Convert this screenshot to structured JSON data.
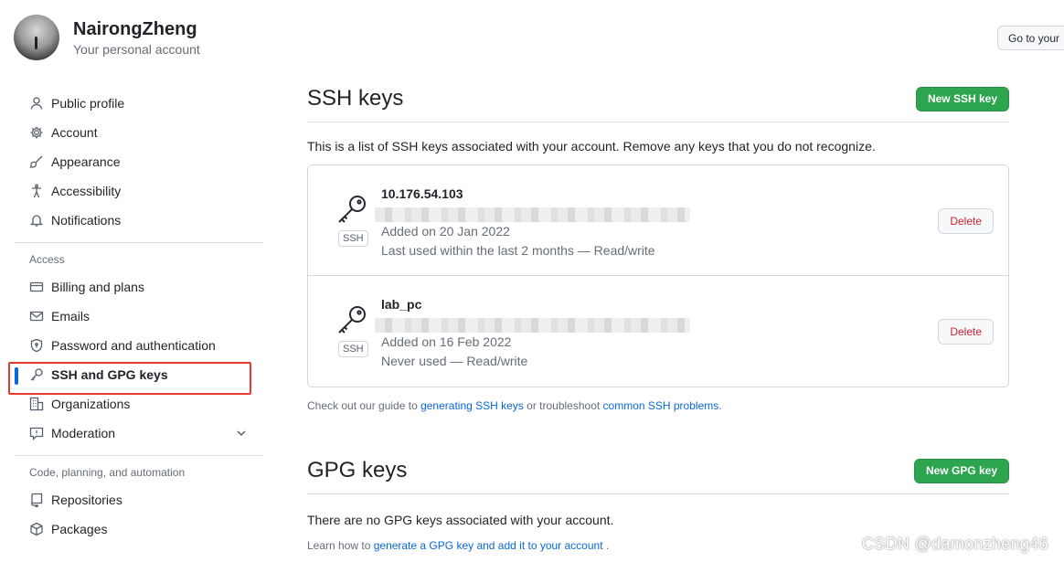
{
  "profile": {
    "name": "NairongZheng",
    "subtitle": "Your personal account",
    "goto_label": "Go to your"
  },
  "sidebar": {
    "items_top": [
      {
        "label": "Public profile",
        "icon": "person-icon"
      },
      {
        "label": "Account",
        "icon": "gear-icon"
      },
      {
        "label": "Appearance",
        "icon": "paintbrush-icon"
      },
      {
        "label": "Accessibility",
        "icon": "accessibility-icon"
      },
      {
        "label": "Notifications",
        "icon": "bell-icon"
      }
    ],
    "access_heading": "Access",
    "items_access": [
      {
        "label": "Billing and plans",
        "icon": "credit-card-icon"
      },
      {
        "label": "Emails",
        "icon": "mail-icon"
      },
      {
        "label": "Password and authentication",
        "icon": "shield-lock-icon"
      },
      {
        "label": "SSH and GPG keys",
        "icon": "key-icon",
        "active": true
      },
      {
        "label": "Organizations",
        "icon": "organization-icon"
      },
      {
        "label": "Moderation",
        "icon": "report-icon"
      }
    ],
    "code_heading": "Code, planning, and automation",
    "items_code": [
      {
        "label": "Repositories",
        "icon": "repo-icon"
      },
      {
        "label": "Packages",
        "icon": "package-icon"
      }
    ]
  },
  "ssh": {
    "title": "SSH keys",
    "new_button": "New SSH key",
    "description": "This is a list of SSH keys associated with your account. Remove any keys that you do not recognize.",
    "badge": "SSH",
    "delete_label": "Delete",
    "keys": [
      {
        "title": "10.176.54.103",
        "added": "Added on 20 Jan 2022",
        "used": "Last used within the last 2 months — Read/write"
      },
      {
        "title": "lab_pc",
        "added": "Added on 16 Feb 2022",
        "used": "Never used — Read/write"
      }
    ],
    "guide_prefix": "Check out our guide to ",
    "guide_link1": "generating SSH keys",
    "guide_middle": " or troubleshoot ",
    "guide_link2": "common SSH problems",
    "guide_suffix": "."
  },
  "gpg": {
    "title": "GPG keys",
    "new_button": "New GPG key",
    "none_text": "There are no GPG keys associated with your account.",
    "learn_prefix": "Learn how to ",
    "learn_link": "generate a GPG key and add it to your account",
    "learn_suffix": " ."
  },
  "watermark": "CSDN @damonzheng46"
}
